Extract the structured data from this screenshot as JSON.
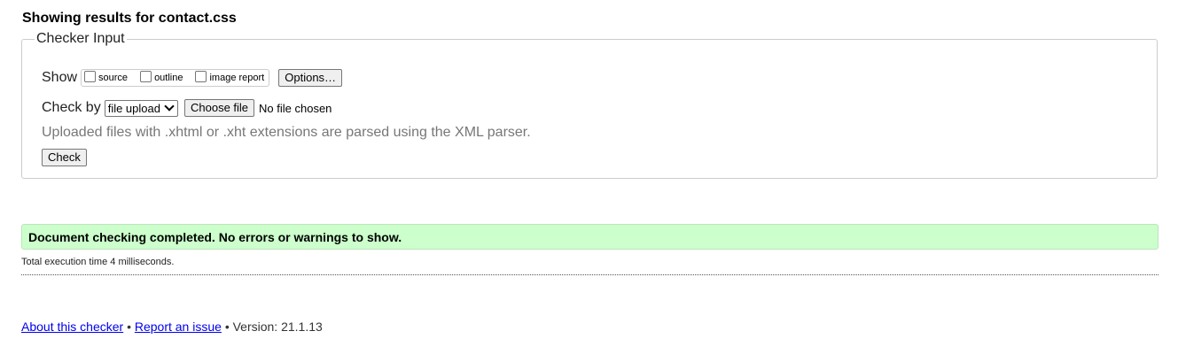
{
  "heading": "Showing results for contact.css",
  "checker_input": {
    "legend": "Checker Input",
    "show_label": "Show",
    "show_options": [
      {
        "label": "source",
        "checked": false
      },
      {
        "label": "outline",
        "checked": false
      },
      {
        "label": "image report",
        "checked": false
      }
    ],
    "options_button": "Options…",
    "check_by_label": "Check by",
    "check_by_selected": "file upload",
    "choose_file_button": "Choose file",
    "file_status": "No file chosen",
    "note": "Uploaded files with .xhtml or .xht extensions are parsed using the XML parser.",
    "check_button": "Check"
  },
  "result": {
    "message": "Document checking completed. No errors or warnings to show.",
    "execution_time": "Total execution time 4 milliseconds."
  },
  "footer": {
    "about_link": "About this checker",
    "separator": "•",
    "report_link": "Report an issue",
    "version": "Version: 21.1.13"
  },
  "colors": {
    "success_bg": "#ccffcc",
    "link": "#0000ee",
    "note": "#777777"
  }
}
